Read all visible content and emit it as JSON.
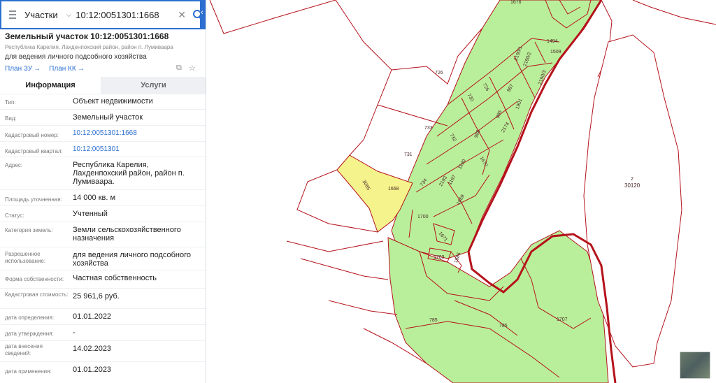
{
  "search": {
    "type_label": "Участки",
    "value": "10:12:0051301:1668"
  },
  "object": {
    "title": "Земельный участок 10:12:0051301:1668",
    "address_line": "Республика Карелия, Лахденпохский район, район п. Лумиваара",
    "purpose_line": "для ведения личного подсобного хозяйства",
    "link_plan_zu": "План ЗУ",
    "link_plan_kk": "План КК"
  },
  "tabs": {
    "info": "Информация",
    "services": "Услуги"
  },
  "info_rows": [
    {
      "label": "Тип:",
      "value": "Объект недвижимости"
    },
    {
      "label": "Вид:",
      "value": "Земельный участок"
    },
    {
      "label": "Кадастровый номер:",
      "value": "10:12:0051301:1668"
    },
    {
      "label": "Кадастровый квартал:",
      "value": "10:12:0051301"
    },
    {
      "label": "Адрес:",
      "value": "Республика Карелия, Лахденпохский район, район п. Лумиваара."
    },
    {
      "label": "Площадь уточненная:",
      "value": "14 000 кв. м"
    },
    {
      "label": "Статус:",
      "value": "Учтенный"
    },
    {
      "label": "Категория земель:",
      "value": "Земли сельскохозяйственного назначения"
    },
    {
      "label": "Разрешенное использование:",
      "value": "для ведения личного подсобного хозяйства"
    },
    {
      "label": "Форма собственности:",
      "value": "Частная собственность"
    },
    {
      "label": "Кадастровая стоимость:",
      "value": "25 961,6 руб."
    },
    {
      "label": "дата определения:",
      "value": "01.01.2022"
    },
    {
      "label": "дата утверждения:",
      "value": "-"
    },
    {
      "label": "дата внесения сведений:",
      "value": "14.02.2023"
    },
    {
      "label": "дата применения:",
      "value": "01.01.2023"
    }
  ],
  "map_labels": {
    "l1676": "1676",
    "l726": "726",
    "l733": "733",
    "l731": "731",
    "l734": "734",
    "l1668": "1668",
    "l3085": "3085",
    "l1700": "1700",
    "l1669": "1669",
    "l1671": "1671",
    "l1703": "1703",
    "l1585": "1585",
    "l785a": "785",
    "l785b": "785",
    "l1707": "1707",
    "l1494": "1494",
    "l1509": "1509",
    "l2190_1": "2190/1",
    "l2190_2": "2190/2",
    "l2190_3": "2190/3",
    "l730": "730",
    "l726b": "726",
    "l987": "987",
    "l985": "985",
    "l1901": "1901",
    "l2174": "2174",
    "l988": "988",
    "l732": "732",
    "l1670": "1670",
    "l1190": "1190",
    "l2193": "2193",
    "l1197": "1197",
    "l2": "2",
    "l30120": "30120"
  },
  "colors": {
    "accent": "#2c6fd1",
    "parcel_green": "#b9ef9a",
    "selected_parcel": "#f5f38c",
    "boundary_red": "#b5121b"
  },
  "icons": [
    "menu-icon",
    "chevron-down-icon",
    "clear-icon",
    "search-icon",
    "arrow-right-icon",
    "crop-icon",
    "star-icon",
    "collapse-icon"
  ]
}
